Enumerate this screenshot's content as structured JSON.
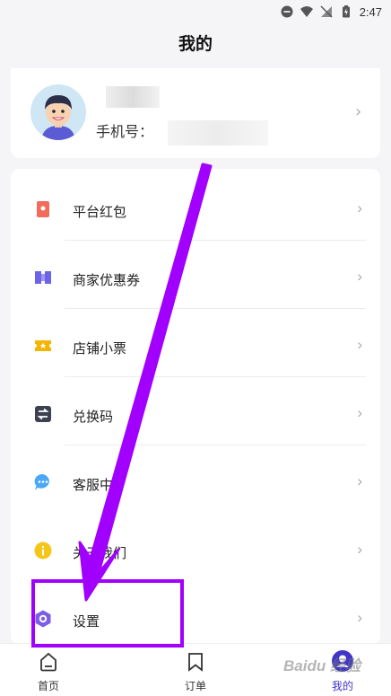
{
  "status_bar": {
    "time": "2:47"
  },
  "header": {
    "title": "我的"
  },
  "profile": {
    "phone_label": "手机号："
  },
  "menu": {
    "items": [
      {
        "label": "平台红包",
        "icon": "red-packet-icon",
        "color": "#f26b5b"
      },
      {
        "label": "商家优惠券",
        "icon": "coupon-icon",
        "color": "#6b63e8"
      },
      {
        "label": "店铺小票",
        "icon": "ticket-icon",
        "color": "#f5b400"
      },
      {
        "label": "兑换码",
        "icon": "exchange-icon",
        "color": "#3d4150"
      },
      {
        "label": "客服中",
        "icon": "chat-bubble-icon",
        "color": "#4aa8f5"
      },
      {
        "label": "关于我们",
        "icon": "info-icon",
        "color": "#f5c518"
      },
      {
        "label": "设置",
        "icon": "settings-hexagon-icon",
        "color": "#7b5de8"
      }
    ]
  },
  "tabbar": {
    "tabs": [
      {
        "label": "首页",
        "icon": "home-icon"
      },
      {
        "label": "订单",
        "icon": "bookmark-icon"
      },
      {
        "label": "我的",
        "icon": "profile-icon",
        "active": true
      }
    ]
  },
  "annotation": {
    "arrow_color": "#a100ff",
    "watermark": "Baidu 经验"
  }
}
